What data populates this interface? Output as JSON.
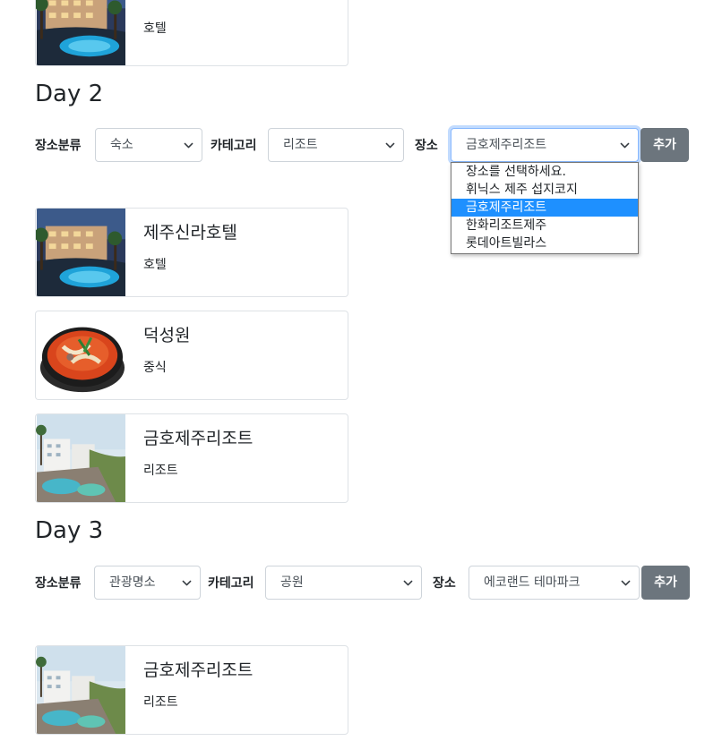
{
  "cards": {
    "top_partial": {
      "subtitle": "호텔"
    },
    "day2_1": {
      "title": "제주신라호텔",
      "subtitle": "호텔"
    },
    "day2_2": {
      "title": "덕성원",
      "subtitle": "중식"
    },
    "day2_3": {
      "title": "금호제주리조트",
      "subtitle": "리조트"
    },
    "day3_1": {
      "title": "금호제주리조트",
      "subtitle": "리조트"
    }
  },
  "day2": {
    "title": "Day 2",
    "category_label": "장소분류",
    "category_value": "숙소",
    "subcategory_label": "카테고리",
    "subcategory_value": "리조트",
    "place_label": "장소",
    "place_value": "금호제주리조트",
    "add_button": "추가",
    "place_options": [
      "장소를 선택하세요.",
      "휘닉스 제주 섭지코지",
      "금호제주리조트",
      "한화리조트제주",
      "롯데아트빌라스"
    ],
    "selected_option_index": 2
  },
  "day3": {
    "title": "Day 3",
    "category_label": "장소분류",
    "category_value": "관광명소",
    "subcategory_label": "카테고리",
    "subcategory_value": "공원",
    "place_label": "장소",
    "place_value": "에코랜드 테마파크",
    "add_button": "추가"
  },
  "colors": {
    "button_bg": "#6c757d",
    "selected_option_bg": "#1e90ff",
    "card_border": "#dee2e6"
  },
  "icons": {
    "select_chevron": "chevron-down-icon"
  }
}
